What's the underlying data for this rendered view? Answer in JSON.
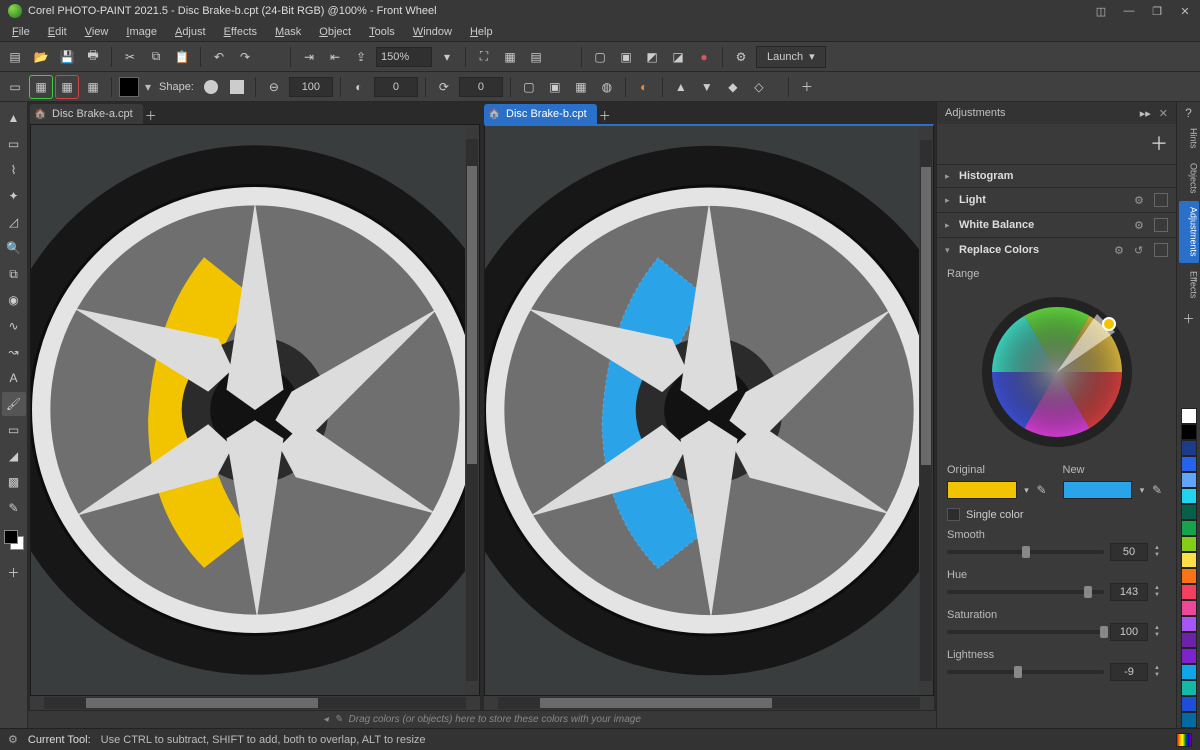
{
  "title": "Corel PHOTO-PAINT 2021.5 - Disc Brake-b.cpt (24-Bit RGB) @100% - Front Wheel",
  "menu": [
    "File",
    "Edit",
    "View",
    "Image",
    "Adjust",
    "Effects",
    "Mask",
    "Object",
    "Tools",
    "Window",
    "Help"
  ],
  "toolbar": {
    "zoom": "150%",
    "launch": "Launch"
  },
  "propbar": {
    "shape_label": "Shape:",
    "size_value": "100",
    "opacity_value": "0",
    "rotate_value": "0"
  },
  "tabs": {
    "a": "Disc Brake-a.cpt",
    "b": "Disc Brake-b.cpt"
  },
  "adjustments": {
    "title": "Adjustments",
    "histogram": "Histogram",
    "light": "Light",
    "white_balance": "White Balance",
    "replace_colors": "Replace Colors",
    "range_label": "Range",
    "original_label": "Original",
    "new_label": "New",
    "original_color": "#f2c400",
    "new_color": "#2aa3e8",
    "single_color": "Single color",
    "smooth": {
      "label": "Smooth",
      "value": "50",
      "pct": 50
    },
    "hue": {
      "label": "Hue",
      "value": "143",
      "pct": 90
    },
    "saturation": {
      "label": "Saturation",
      "value": "100",
      "pct": 100
    },
    "lightness": {
      "label": "Lightness",
      "value": "-9",
      "pct": 45
    }
  },
  "dock_tabs": [
    "Hints",
    "Objects",
    "Adjustments",
    "Effects"
  ],
  "dock_active": 2,
  "swatches": [
    "#ffffff",
    "#000000",
    "#1e3a8a",
    "#2563eb",
    "#60a5fa",
    "#22d3ee",
    "#065f46",
    "#16a34a",
    "#84cc16",
    "#fde047",
    "#f97316",
    "#f43f5e",
    "#ec4899",
    "#a855f7",
    "#6b21a8",
    "#7e22ce",
    "#0ea5e9",
    "#14b8a6",
    "#1d4ed8",
    "#0369a1"
  ],
  "tray_hint": "Drag colors (or objects) here to store these colors with your image",
  "status": {
    "tool_label": "Current Tool:",
    "hint": "Use CTRL to subtract, SHIFT to add, both to overlap, ALT to resize"
  }
}
